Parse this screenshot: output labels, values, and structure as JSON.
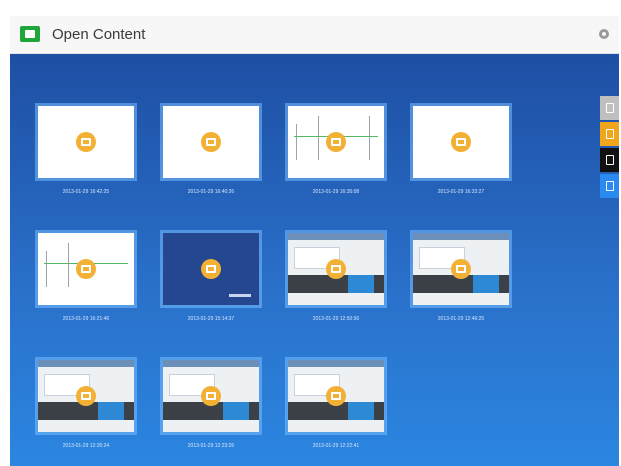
{
  "window": {
    "title": "Open Content",
    "close_icon": "close-icon"
  },
  "colors": {
    "accent": "#1fa53a",
    "background_top": "#1e4fa4",
    "background_bottom": "#2b86e0",
    "badge": "#f2b134"
  },
  "items": [
    {
      "timestamp": "2013-01-29 16:42:25",
      "thumbnail": "blank"
    },
    {
      "timestamp": "2013-01-29 16:40:26",
      "thumbnail": "blank"
    },
    {
      "timestamp": "2013-01-29 16:35:08",
      "thumbnail": "sketch"
    },
    {
      "timestamp": "2013-01-29 16:33:27",
      "thumbnail": "blank"
    },
    {
      "timestamp": "2013-01-29 16:21:46",
      "thumbnail": "sketch"
    },
    {
      "timestamp": "2013-01-29 15:14:37",
      "thumbnail": "dark"
    },
    {
      "timestamp": "2013-01-29 12:50:56",
      "thumbnail": "screen"
    },
    {
      "timestamp": "2013-01-29 12:46:25",
      "thumbnail": "screen"
    },
    {
      "timestamp": "2013-01-29 12:35:24",
      "thumbnail": "screen"
    },
    {
      "timestamp": "2013-01-29 12:23:26",
      "thumbnail": "screen"
    },
    {
      "timestamp": "2013-01-29 12:22:41",
      "thumbnail": "screen"
    }
  ],
  "sidebar": [
    {
      "icon": "trash-icon",
      "color": "#bfbfbf"
    },
    {
      "icon": "open-icon",
      "color": "#f0a61c"
    },
    {
      "icon": "save-icon",
      "color": "#111111"
    },
    {
      "icon": "new-file-icon",
      "color": "#2a8af0"
    }
  ]
}
